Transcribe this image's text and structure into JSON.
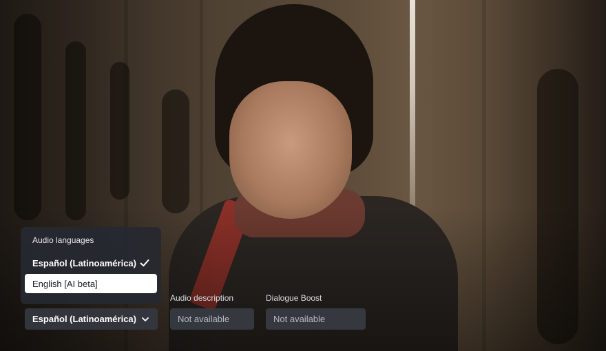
{
  "audio_menu": {
    "title": "Audio languages",
    "options": [
      {
        "label": "Español (Latinoamérica)",
        "state": "selected"
      },
      {
        "label": "English [AI beta]",
        "state": "focused"
      }
    ]
  },
  "controls": {
    "audio_language": {
      "value": "Español (Latinoamérica)"
    },
    "audio_description": {
      "label": "Audio description",
      "value": "Not available"
    },
    "dialogue_boost": {
      "label": "Dialogue Boost",
      "value": "Not available"
    }
  },
  "icons": {
    "selected_indicator": "checkmark-icon",
    "dropdown_indicator": "chevron-down-icon"
  },
  "colors": {
    "panel_bg": "#262930",
    "focus_bg": "#ffffff",
    "focus_text": "#1a1c22",
    "disabled_text": "#b5b9c1"
  }
}
